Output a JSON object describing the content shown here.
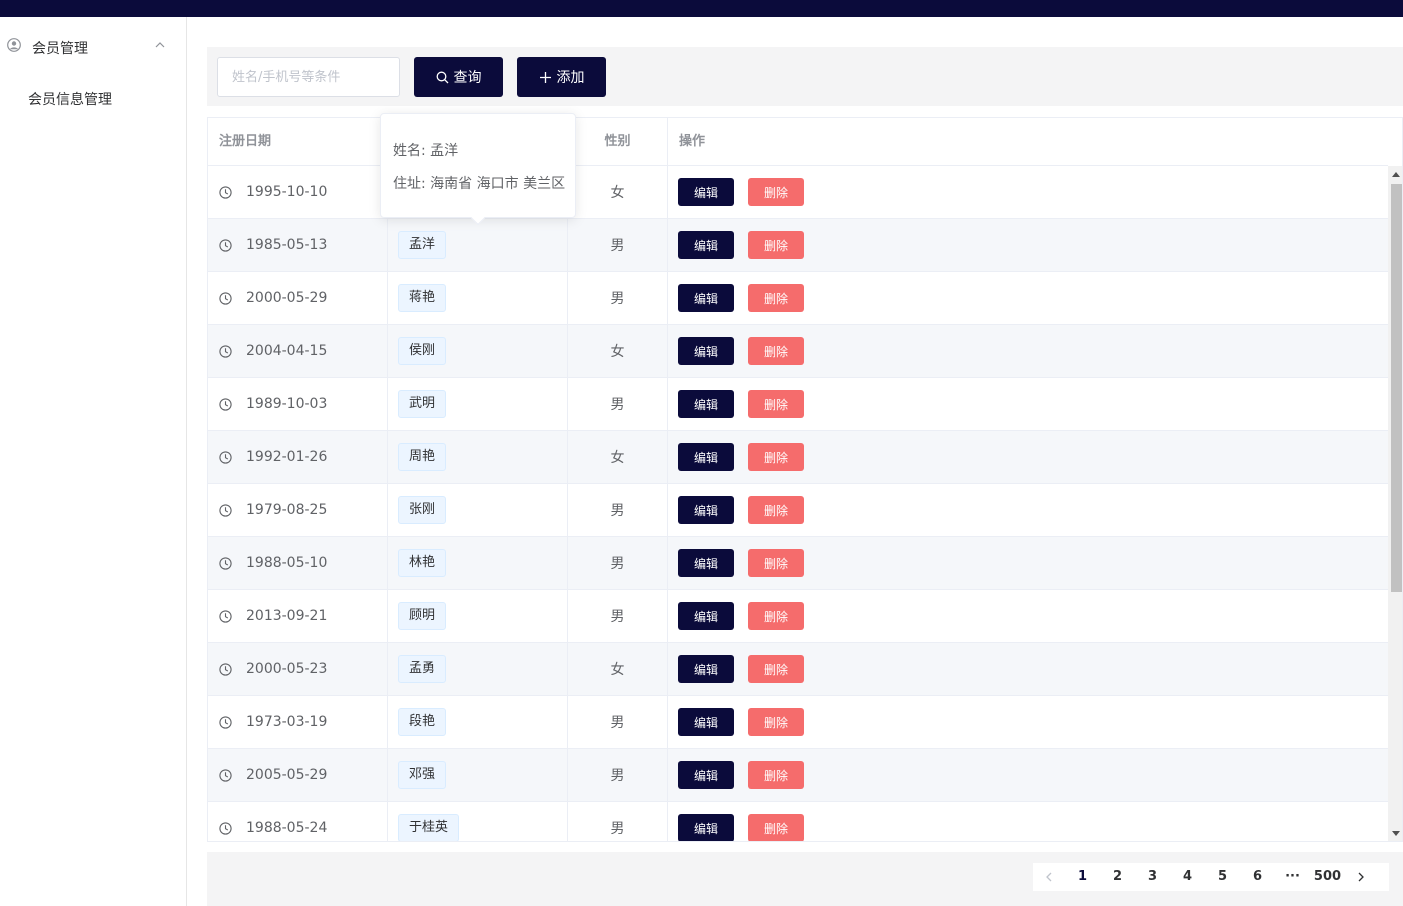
{
  "sidebar": {
    "menu_title": "会员管理",
    "submenu": "会员信息管理"
  },
  "toolbar": {
    "search_placeholder": "姓名/手机号等条件",
    "search_label": "查询",
    "add_label": "添加"
  },
  "table": {
    "headers": {
      "date": "注册日期",
      "name": "",
      "sex": "性别",
      "op": "操作"
    },
    "edit_label": "编辑",
    "delete_label": "删除",
    "rows": [
      {
        "date": "1995-10-10",
        "name": "",
        "sex": "女"
      },
      {
        "date": "1985-05-13",
        "name": "孟洋",
        "sex": "男"
      },
      {
        "date": "2000-05-29",
        "name": "蒋艳",
        "sex": "男"
      },
      {
        "date": "2004-04-15",
        "name": "侯刚",
        "sex": "女"
      },
      {
        "date": "1989-10-03",
        "name": "武明",
        "sex": "男"
      },
      {
        "date": "1992-01-26",
        "name": "周艳",
        "sex": "女"
      },
      {
        "date": "1979-08-25",
        "name": "张刚",
        "sex": "男"
      },
      {
        "date": "1988-05-10",
        "name": "林艳",
        "sex": "男"
      },
      {
        "date": "2013-09-21",
        "name": "顾明",
        "sex": "男"
      },
      {
        "date": "2000-05-23",
        "name": "孟勇",
        "sex": "女"
      },
      {
        "date": "1973-03-19",
        "name": "段艳",
        "sex": "男"
      },
      {
        "date": "2005-05-29",
        "name": "邓强",
        "sex": "男"
      },
      {
        "date": "1988-05-24",
        "name": "于桂英",
        "sex": "男"
      }
    ]
  },
  "tooltip": {
    "name_line": "姓名: 孟洋",
    "address_line": "住址: 海南省 海口市 美兰区"
  },
  "pagination": {
    "pages": [
      "1",
      "2",
      "3",
      "4",
      "5",
      "6"
    ],
    "ellipsis": "···",
    "last": "500",
    "current": "1"
  },
  "colors": {
    "primary_dark": "#0b0b3b",
    "danger": "#f56c6c",
    "tag_bg": "#ecf5ff"
  }
}
